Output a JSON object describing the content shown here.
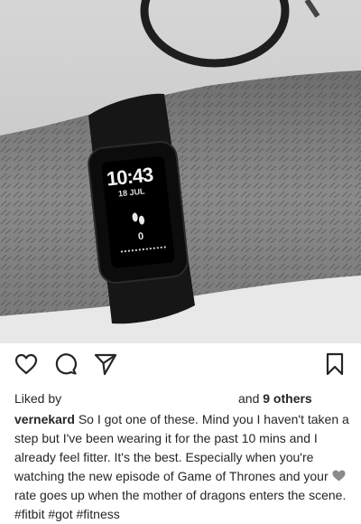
{
  "post": {
    "photo": {
      "alt_icon": "fitbit-photo",
      "tracker_time": "10:43",
      "tracker_date": "18 JUL",
      "tracker_steps": "0",
      "tracker_step_icon": "footprints-icon"
    },
    "actions": {
      "like_icon": "heart-outline-icon",
      "comment_icon": "comment-bubble-icon",
      "share_icon": "paper-plane-icon",
      "save_icon": "bookmark-icon"
    },
    "likes": {
      "prefix": "Liked by",
      "and": "and",
      "others_count": "9 others"
    },
    "caption": {
      "username": "vernekard",
      "text_before_heart": "So I got one of these. Mind you I haven't taken a step but I've been wearing it for the past 10 mins and I already feel fitter. It's the best. Especially when you're watching the new episode of Game of Thrones and your",
      "heart_icon": "grey-heart-emoji",
      "text_after_heart": "rate goes up when the mother of dragons enters the scene. #fitbit #got #fitness"
    },
    "colors": {
      "text": "#262626",
      "icon": "#262626",
      "heart_emoji": "#8a8a8a"
    }
  }
}
